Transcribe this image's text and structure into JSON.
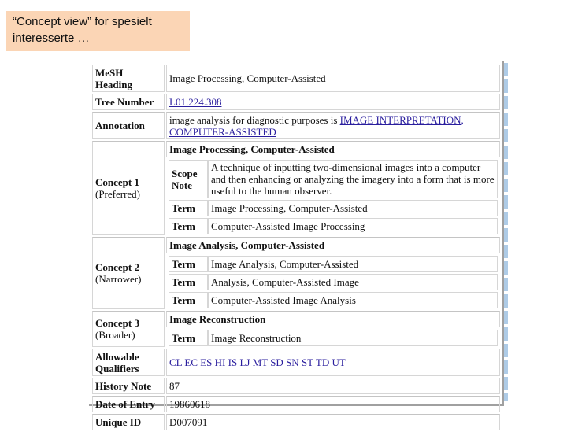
{
  "callout": {
    "line1": "“Concept view” for spesielt",
    "line2": "interesserte …"
  },
  "record": {
    "mesh_heading": {
      "label_line1": "MeSH",
      "label_line2": "Heading",
      "value": "Image Processing, Computer-Assisted"
    },
    "tree_number": {
      "label": "Tree Number",
      "value": "L01.224.308"
    },
    "annotation": {
      "label": "Annotation",
      "text": "image analysis for diagnostic purposes is ",
      "link_line1": "IMAGE INTERPRETATION,",
      "link_line2": "COMPUTER-ASSISTED"
    },
    "concepts": [
      {
        "label": "Concept 1",
        "relation": "(Preferred)",
        "name": "Image Processing, Computer-Assisted",
        "scope_note_label_line1": "Scope",
        "scope_note_label_line2": "Note",
        "scope_note": "A technique of inputting two-dimensional images into a computer and then enhancing or analyzing the imagery into a form that is more useful to the human observer.",
        "terms": [
          {
            "label": "Term",
            "value": "Image Processing, Computer-Assisted"
          },
          {
            "label": "Term",
            "value": "Computer-Assisted Image Processing"
          }
        ]
      },
      {
        "label": "Concept 2",
        "relation": "(Narrower)",
        "name": "Image Analysis,  Computer-Assisted",
        "terms": [
          {
            "label": "Term",
            "value": "Image Analysis, Computer-Assisted"
          },
          {
            "label": "Term",
            "value": "Analysis, Computer-Assisted Image"
          },
          {
            "label": "Term",
            "value": "Computer-Assisted Image Analysis"
          }
        ]
      },
      {
        "label": "Concept 3",
        "relation": "(Broader)",
        "name": "Image Reconstruction",
        "terms": [
          {
            "label": "Term",
            "value": "Image Reconstruction"
          }
        ]
      }
    ],
    "allowable_qualifiers": {
      "label_line1": "Allowable",
      "label_line2": "Qualifiers",
      "value": "CL EC ES HI IS LJ MT SD SN ST TD UT"
    },
    "history_note": {
      "label": "History Note",
      "value": "87"
    },
    "date_of_entry": {
      "label": "Date of Entry",
      "value": "19860618"
    },
    "unique_id": {
      "label": "Unique ID",
      "value": "D007091"
    }
  }
}
